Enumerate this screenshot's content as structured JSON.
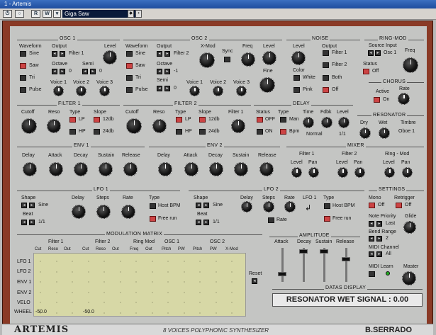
{
  "window": {
    "title": "1 - Artemis"
  },
  "toolbar": {
    "preset": "Giga Saw",
    "btns": [
      "⏻",
      "○",
      "R",
      "W"
    ]
  },
  "osc1": {
    "title": "OSC 1",
    "waveform": "Waveform",
    "output": "Output",
    "level": "Level",
    "sine": "Sine",
    "saw": "Saw",
    "tri": "Tri",
    "pulse": "Pulse",
    "filter": "Filter 1",
    "octave": "Octave",
    "octave_val": "0",
    "semi": "Semi",
    "semi_val": "0",
    "v1": "Voice 1",
    "v2": "Voice 2",
    "v3": "Voice 3"
  },
  "osc2": {
    "title": "OSC 2",
    "waveform": "Waveform",
    "output": "Output",
    "xmod": "X-Mod",
    "freq": "Freq",
    "level": "Level",
    "sync": "Sync",
    "fine": "Fine",
    "sine": "Sine",
    "saw": "Saw",
    "tri": "Tri",
    "pulse": "Pulse",
    "filter": "Filter 2",
    "octave": "Octave",
    "octave_val": "-1",
    "semi": "Semi",
    "semi_val": "0",
    "v1": "Voice 1",
    "v2": "Voice 2",
    "v3": "Voice 3"
  },
  "noise": {
    "title": "NOISE",
    "level": "Level",
    "output": "Output",
    "f1": "Filter 1",
    "f2": "Filter 2",
    "color": "Color",
    "white": "White",
    "pink": "Pink",
    "both": "Both",
    "off": "Off"
  },
  "ringmod": {
    "title": "RING-MOD",
    "source": "Source Input",
    "osc": "Osc 1",
    "freq": "Freq",
    "status": "Status",
    "off": "Off"
  },
  "chorus": {
    "title": "CHORUS",
    "active": "Active",
    "on": "On",
    "rate": "Rate"
  },
  "filter1": {
    "title": "FILTER 1",
    "cutoff": "Cutoff",
    "reso": "Reso",
    "type": "Type",
    "slope": "Slope",
    "lp": "LP",
    "hp": "HP",
    "s12": "12db",
    "s24": "24db"
  },
  "filter2": {
    "title": "FILTER 2",
    "cutoff": "Cutoff",
    "reso": "Reso",
    "type": "Type",
    "slope": "Slope",
    "filter1": "Filter 1",
    "lp": "LP",
    "hp": "HP",
    "s12": "12db",
    "s24": "24db"
  },
  "delay": {
    "title": "DELAY",
    "status": "Status",
    "type": "Type",
    "time": "Time",
    "fdbk": "Fdbk",
    "level": "Level",
    "off": "OFF",
    "on": "ON",
    "man": "Man",
    "bpm": "Bpm",
    "normal": "Normal",
    "ratio": "1/1"
  },
  "resonator": {
    "title": "RESONATOR",
    "dry": "Dry",
    "wet": "Wet",
    "timbre": "Timbre",
    "oboe": "Oboe 1"
  },
  "env1": {
    "title": "ENV 1",
    "delay": "Delay",
    "attack": "Attack",
    "decay": "Decay",
    "sustain": "Sustain",
    "release": "Release"
  },
  "env2": {
    "title": "ENV 2",
    "delay": "Delay",
    "attack": "Attack",
    "decay": "Decay",
    "sustain": "Sustain",
    "release": "Release"
  },
  "mixer": {
    "title": "MIXER",
    "filter1": "Filter 1",
    "filter2": "Filter 2",
    "ringmod": "Ring - Mod",
    "level": "Level",
    "pan": "Pan"
  },
  "lfo1": {
    "title": "LFO 1",
    "shape": "Shape",
    "sine": "Sine",
    "delay": "Delay",
    "steps": "Steps",
    "rate": "Rate",
    "type": "Type",
    "host": "Host BPM",
    "free": "Free run",
    "beat": "Beat",
    "beat_val": "1/1"
  },
  "lfo2": {
    "title": "LFO 2",
    "shape": "Shape",
    "sine": "Sine",
    "delay": "Delay",
    "steps": "Steps",
    "rate": "Rate",
    "lfo1": "LFO 1",
    "type": "Type",
    "host": "Host BPM",
    "free": "Free run",
    "beat": "Beat",
    "beat_val": "1/1"
  },
  "settings": {
    "title": "SETTINGS",
    "mono": "Mono",
    "off": "Off",
    "retrigger": "Retrigger",
    "priority": "Note Priority",
    "last": "Last",
    "glide": "Glide",
    "bend": "Bend Range",
    "bend_val": "2",
    "midich": "MIDI Channel",
    "all": "All",
    "learn": "MIDI Learn",
    "master": "Master"
  },
  "matrix": {
    "title": "MODULATION MATRIX",
    "groups": [
      "Filter 1",
      "Filter 2",
      "Ring Mod",
      "OSC 1",
      "OSC 2"
    ],
    "cols": [
      "Cut",
      "Reso",
      "Out",
      "Cut",
      "Reso",
      "Out",
      "Freq",
      "Out",
      "Pitch",
      "PW",
      "Pitch",
      "PW",
      "X-Mod"
    ],
    "rows": [
      "LFO 1",
      "LFO 2",
      "ENV 1",
      "ENV 2",
      "VELO",
      "WHEEL"
    ],
    "val1": "-50.0",
    "val2": "-50.0",
    "reset": "Reset"
  },
  "amplitude": {
    "title": "AMPLITUDE",
    "attack": "Attack",
    "decay": "Decay",
    "sustain": "Sustain",
    "release": "Release"
  },
  "display": {
    "title": "DATAS DISPLAY",
    "text": "RESONATOR WET SIGNAL : 0.00"
  },
  "footer": {
    "brand": "ARTEMIS",
    "subtitle": "8 VOICES POLYPHONIC SYNTHESIZER",
    "maker": "B.SERRADO"
  }
}
